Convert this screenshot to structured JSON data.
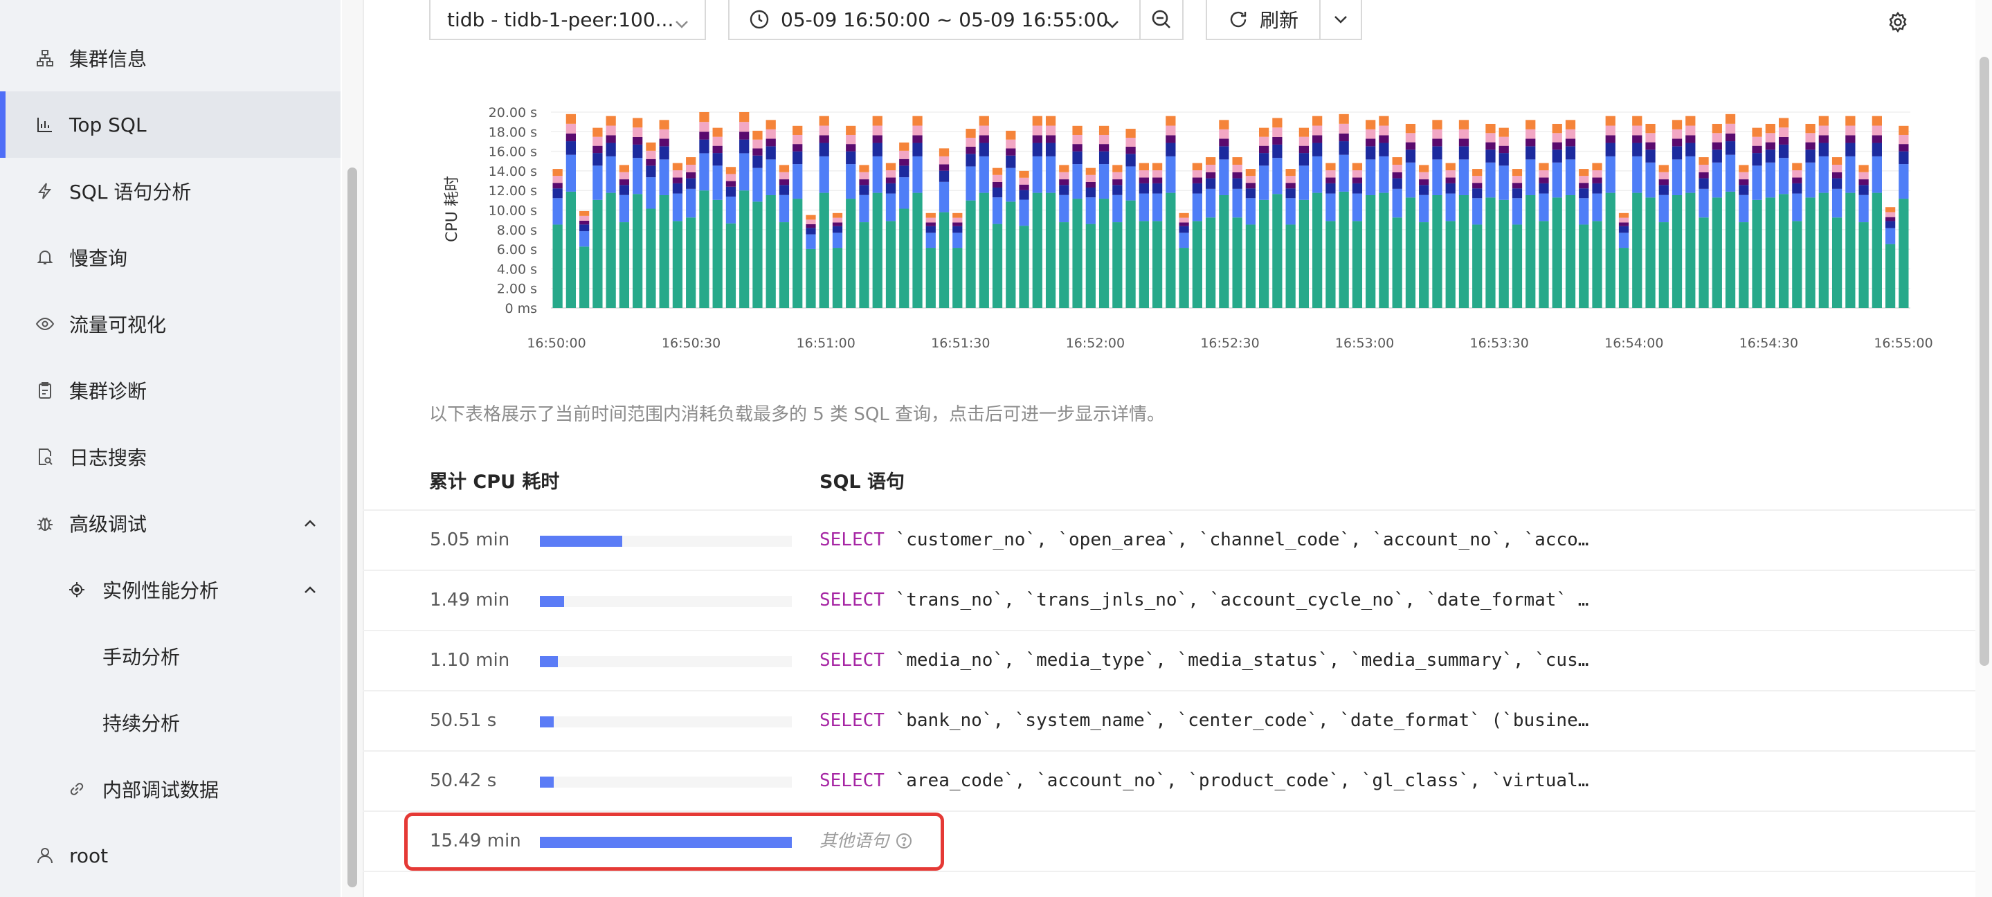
{
  "sidebar": {
    "items": [
      {
        "label": "集群信息",
        "icon": "cluster-icon"
      },
      {
        "label": "Top SQL",
        "icon": "bar-chart-icon"
      },
      {
        "label": "SQL 语句分析",
        "icon": "lightning-icon"
      },
      {
        "label": "慢查询",
        "icon": "bell-icon"
      },
      {
        "label": "流量可视化",
        "icon": "eye-icon"
      },
      {
        "label": "集群诊断",
        "icon": "clipboard-icon"
      },
      {
        "label": "日志搜索",
        "icon": "file-search-icon"
      },
      {
        "label": "高级调试",
        "icon": "bug-icon"
      },
      {
        "label": "实例性能分析",
        "icon": "target-icon"
      },
      {
        "label": "手动分析"
      },
      {
        "label": "持续分析"
      },
      {
        "label": "内部调试数据",
        "icon": "link-icon"
      },
      {
        "label": "root",
        "icon": "user-icon"
      }
    ]
  },
  "toolbar": {
    "instance": "tidb - tidb-1-peer:100...",
    "time_range": "05-09 16:50:00 ~ 05-09 16:55:00",
    "refresh": "刷新"
  },
  "colors": {
    "teal": "#27a98a",
    "blue": "#4f7ef7",
    "navy": "#1c2a9e",
    "purple": "#5a0a6e",
    "pink": "#f2a7c4",
    "orange": "#f5843a",
    "accent": "#4f6ef7",
    "highlight": "#e53935"
  },
  "chart_data": {
    "type": "bar",
    "stacked": true,
    "ylabel": "CPU 耗时",
    "y_ticks": [
      "0 ms",
      "2.00 s",
      "4.00 s",
      "6.00 s",
      "8.00 s",
      "10.00 s",
      "12.00 s",
      "14.00 s",
      "16.00 s",
      "18.00 s",
      "20.00 s"
    ],
    "ylim_seconds": [
      0,
      20
    ],
    "x_ticks": [
      "16:50:00",
      "16:50:30",
      "16:51:00",
      "16:51:30",
      "16:52:00",
      "16:52:30",
      "16:53:00",
      "16:53:30",
      "16:54:00",
      "16:54:30",
      "16:55:00"
    ],
    "x_range": [
      "16:50:00",
      "16:55:00"
    ],
    "bar_interval_seconds": 3,
    "series_colors": [
      "#27a98a",
      "#4f7ef7",
      "#1c2a9e",
      "#5a0a6e",
      "#f2a7c4",
      "#f5843a"
    ],
    "totals_seconds": [
      14.2,
      19.8,
      9.8,
      18.4,
      19.6,
      14.6,
      19.4,
      16.9,
      19.2,
      14.8,
      15.4,
      20.0,
      18.4,
      14.4,
      20.0,
      18.1,
      19.2,
      14.6,
      18.6,
      9.4,
      19.6,
      9.6,
      18.6,
      14.6,
      19.6,
      14.8,
      16.9,
      19.6,
      9.6,
      16.3,
      9.6,
      18.3,
      19.6,
      14.3,
      18.1,
      14.0,
      19.6,
      19.6,
      14.6,
      18.6,
      14.3,
      18.6,
      14.6,
      18.3,
      14.8,
      14.8,
      19.6,
      9.6,
      14.8,
      15.4,
      19.2,
      15.4,
      14.2,
      18.4,
      19.4,
      14.2,
      18.4,
      19.6,
      14.8,
      19.8,
      14.8,
      19.2,
      19.6,
      15.4,
      18.8,
      14.6,
      19.2,
      14.8,
      19.2,
      14.2,
      18.8,
      18.4,
      14.2,
      19.2,
      14.8,
      18.8,
      19.2,
      14.2,
      14.8,
      19.6,
      9.6,
      19.6,
      18.8,
      14.6,
      19.2,
      19.6,
      15.4,
      18.8,
      19.8,
      14.6,
      18.4,
      18.8,
      19.4,
      14.8,
      18.8,
      19.6,
      15.4,
      19.6,
      14.6,
      19.6,
      10.2,
      18.6
    ]
  },
  "description": "以下表格展示了当前时间范围内消耗负载最多的 5 类 SQL 查询，点击后可进一步显示详情。",
  "table": {
    "headers": {
      "cpu": "累计 CPU 耗时",
      "sql": "SQL 语句"
    },
    "rows": [
      {
        "cpu": "5.05 min",
        "pct": 0.326,
        "kw": "SELECT",
        "sql": " `customer_no`, `open_area`, `channel_code`, `account_no`, `acco…"
      },
      {
        "cpu": "1.49 min",
        "pct": 0.096,
        "kw": "SELECT",
        "sql": " `trans_no`, `trans_jnls_no`, `account_cycle_no`, `date_format` …"
      },
      {
        "cpu": "1.10 min",
        "pct": 0.071,
        "kw": "SELECT",
        "sql": " `media_no`, `media_type`, `media_status`, `media_summary`, `cus…"
      },
      {
        "cpu": "50.51 s",
        "pct": 0.054,
        "kw": "SELECT",
        "sql": " `bank_no`, `system_name`, `center_code`, `date_format` (`busine…"
      },
      {
        "cpu": "50.42 s",
        "pct": 0.054,
        "kw": "SELECT",
        "sql": " `area_code`, `account_no`, `product_code`, `gl_class`, `virtual…"
      }
    ],
    "other": {
      "cpu": "15.49 min",
      "pct": 1.0,
      "label": "其他语句"
    }
  }
}
